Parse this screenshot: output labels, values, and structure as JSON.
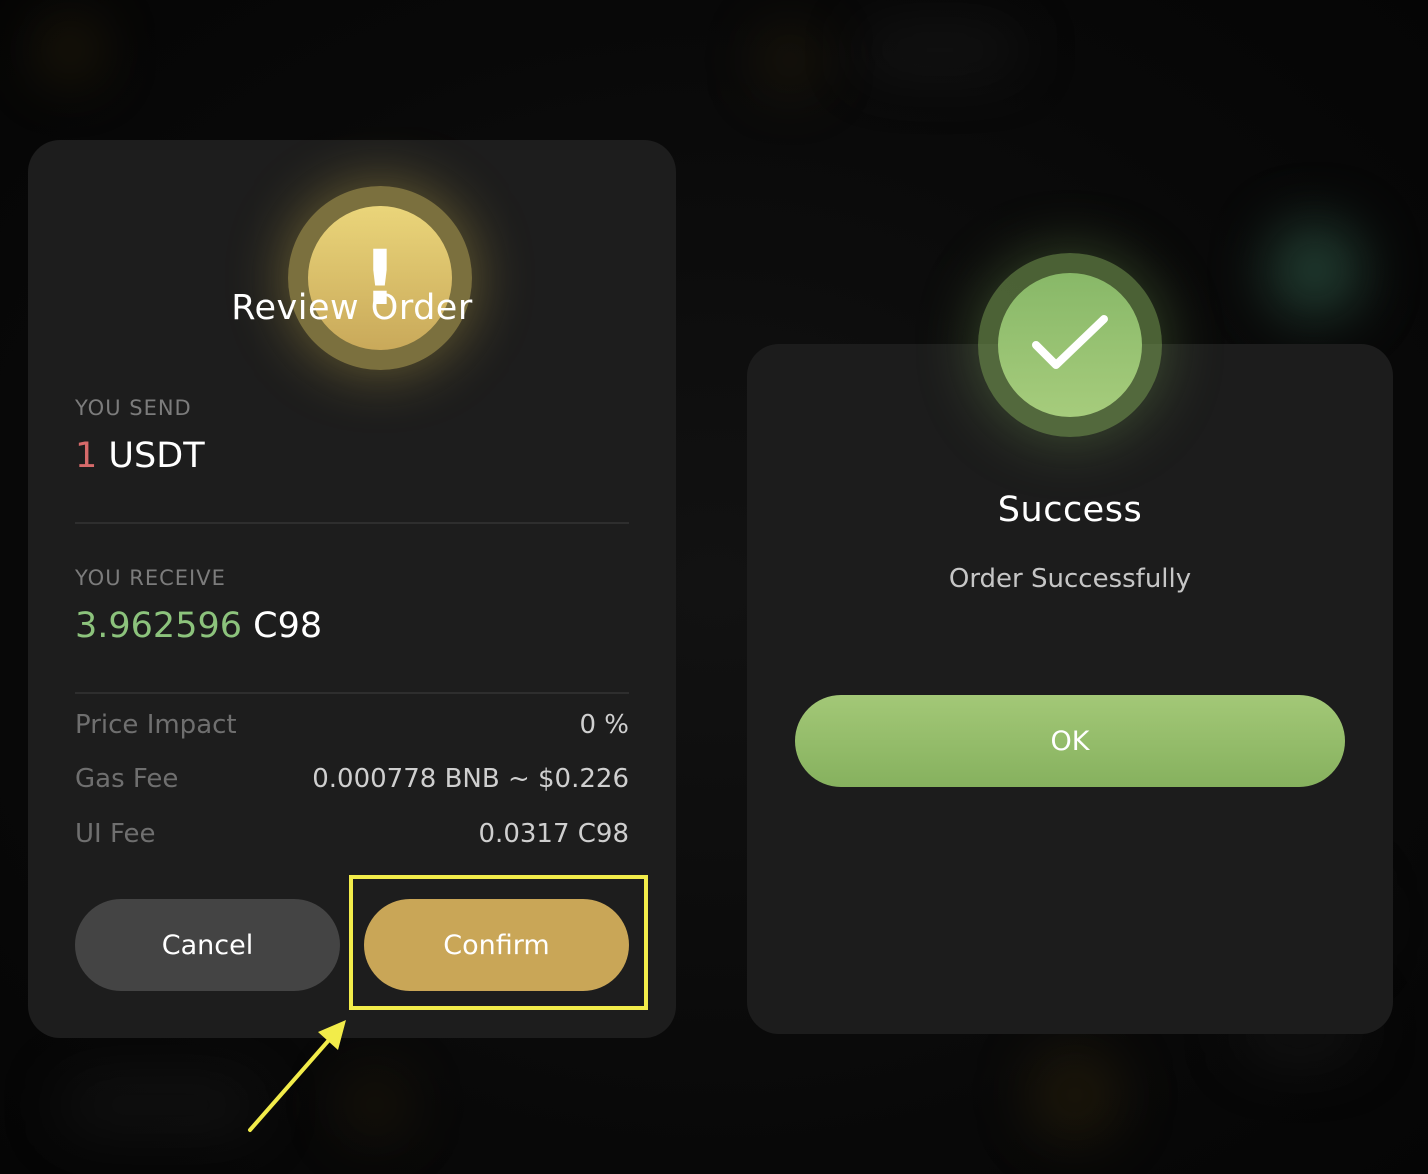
{
  "review": {
    "icon": "exclamation-icon",
    "icon_glyph": "!",
    "title": "Review Order",
    "send_label": "YOU SEND",
    "send_amount": "1",
    "send_unit": "USDT",
    "receive_label": "YOU RECEIVE",
    "receive_amount": "3.962596",
    "receive_unit": "C98",
    "details": [
      {
        "label": "Price Impact",
        "value": "0 %"
      },
      {
        "label": "Gas Fee",
        "value": "0.000778 BNB ~ $0.226"
      },
      {
        "label": "UI Fee",
        "value": "0.0317 C98"
      }
    ],
    "cancel_label": "Cancel",
    "confirm_label": "Confirm"
  },
  "success": {
    "icon": "checkmark-icon",
    "title": "Success",
    "subtitle": "Order Successfully",
    "ok_label": "OK"
  },
  "annotation": {
    "highlight": "confirm-button",
    "arrow_icon": "arrow-pointer-icon"
  },
  "colors": {
    "card_bg": "#1d1d1d",
    "confirm": "#c9a657",
    "cancel": "#444444",
    "ok": "#96bd6a",
    "send_amount": "#d66a6a",
    "receive_amount": "#8cc37c",
    "highlight": "#f2ec4a"
  }
}
